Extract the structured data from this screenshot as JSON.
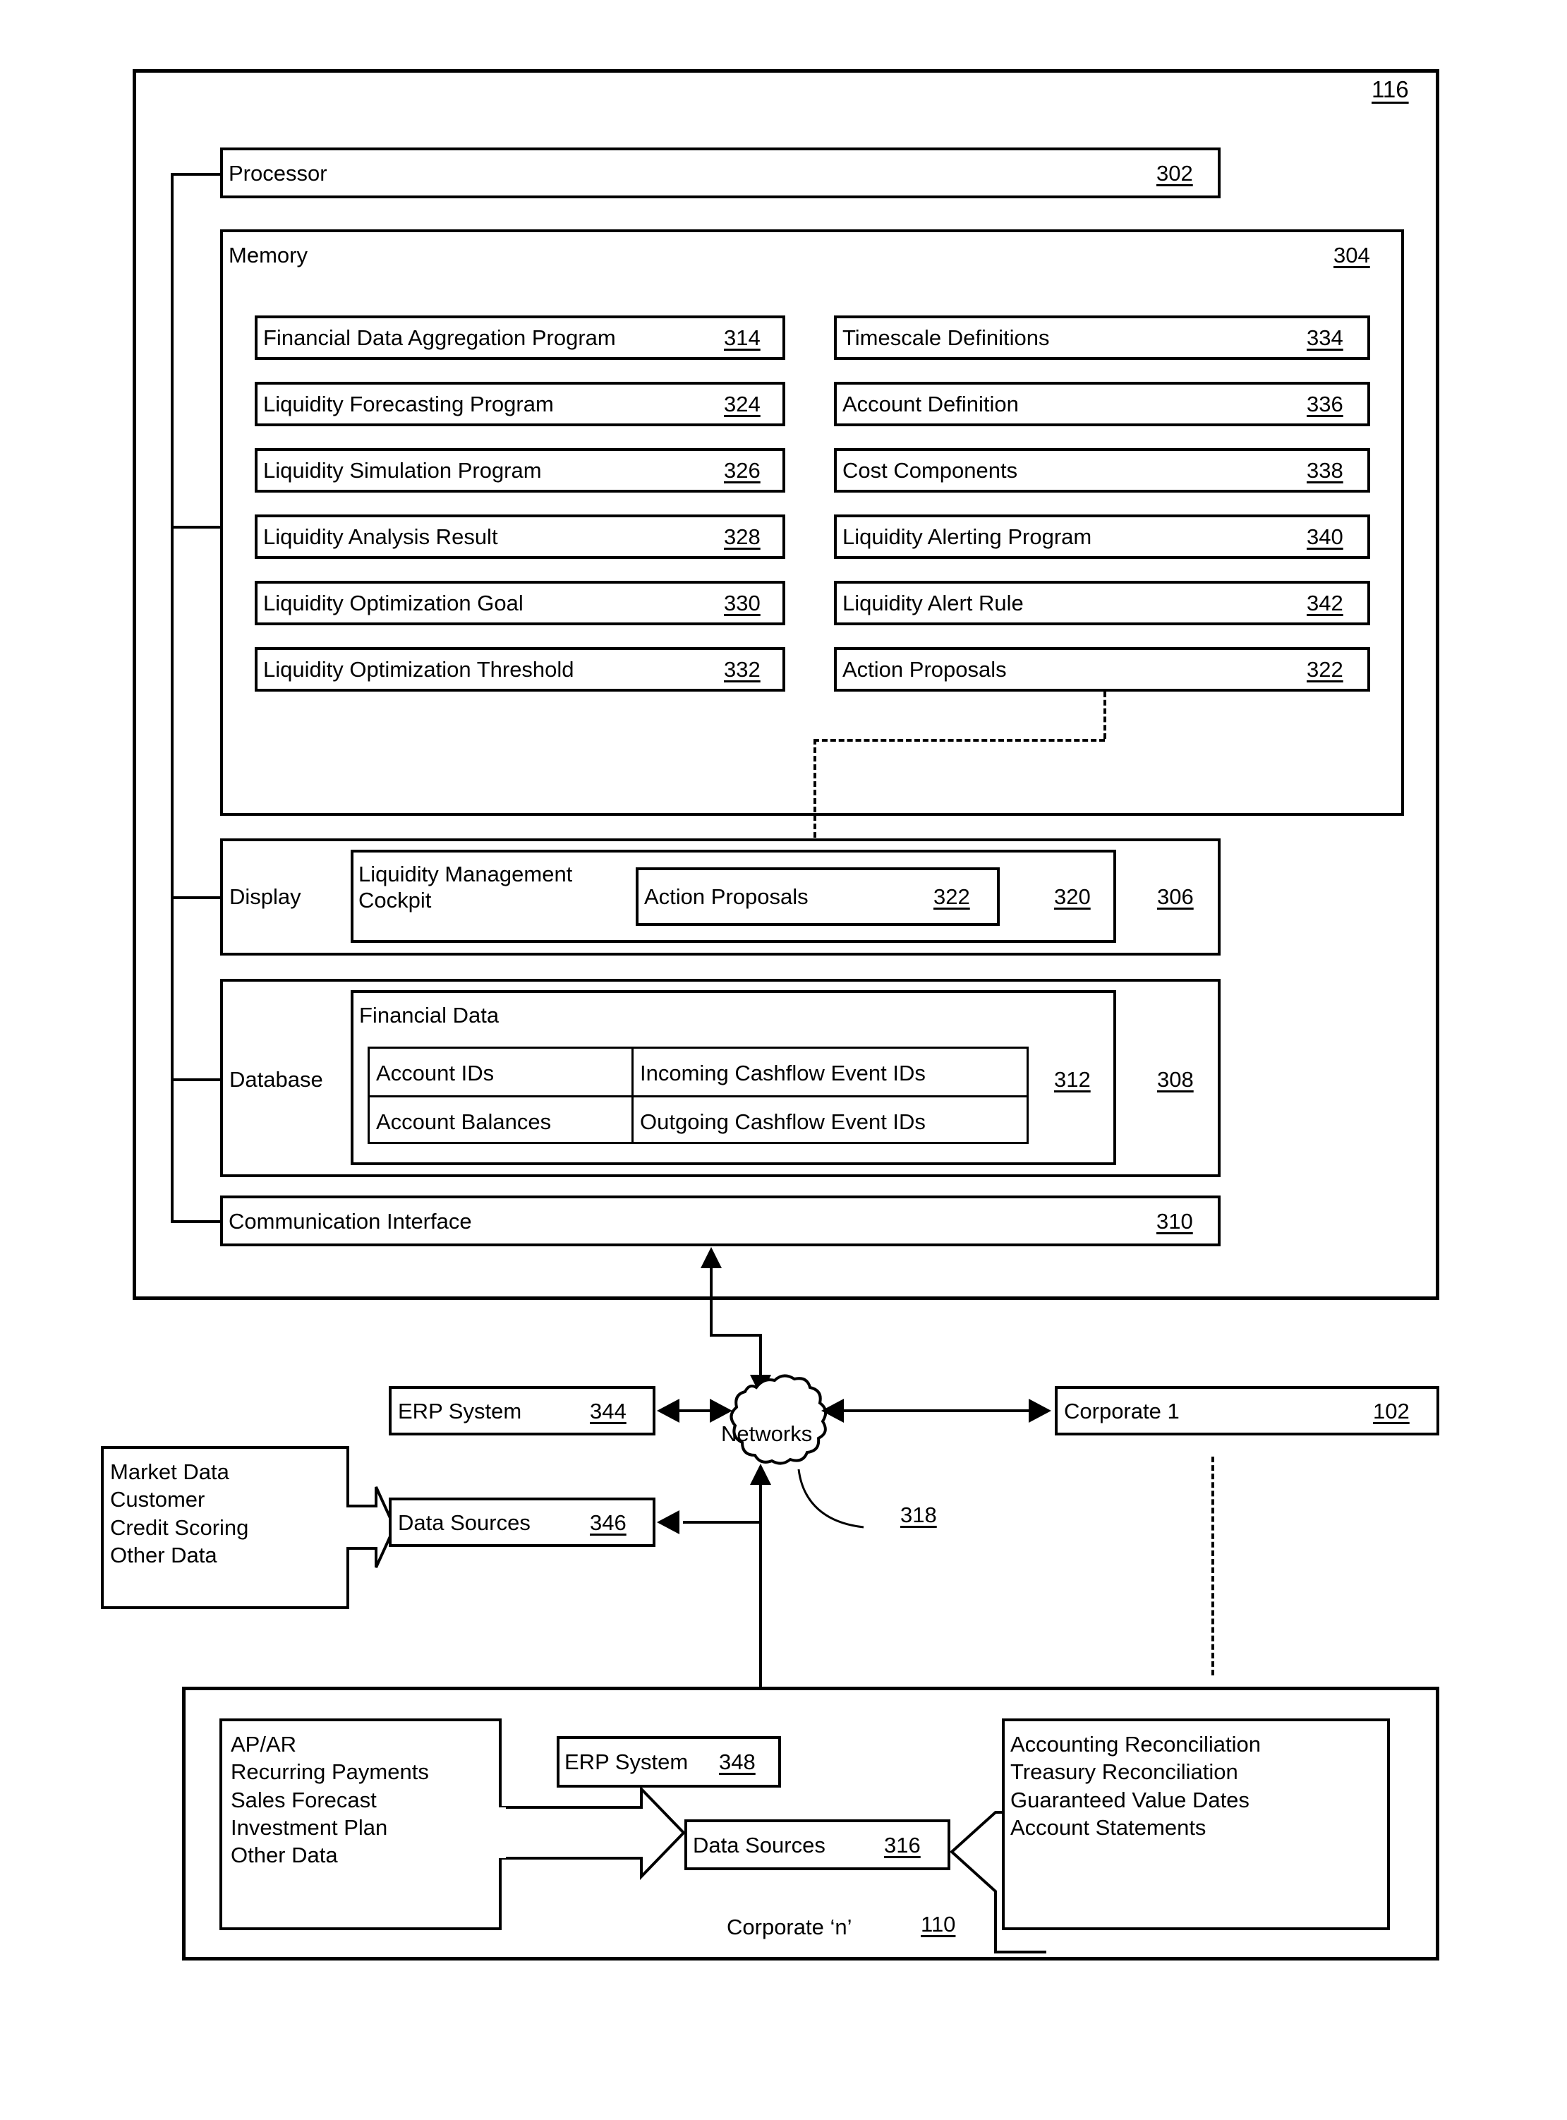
{
  "figure": {
    "system_ref": "116",
    "processor": {
      "label": "Processor",
      "ref": "302"
    },
    "memory": {
      "label": "Memory",
      "ref": "304",
      "left_modules": [
        {
          "label": "Financial Data Aggregation Program",
          "ref": "314"
        },
        {
          "label": "Liquidity Forecasting Program",
          "ref": "324"
        },
        {
          "label": "Liquidity Simulation Program",
          "ref": "326"
        },
        {
          "label": "Liquidity Analysis Result",
          "ref": "328"
        },
        {
          "label": "Liquidity Optimization Goal",
          "ref": "330"
        },
        {
          "label": "Liquidity Optimization Threshold",
          "ref": "332"
        }
      ],
      "right_modules": [
        {
          "label": "Timescale Definitions",
          "ref": "334"
        },
        {
          "label": "Account Definition",
          "ref": "336"
        },
        {
          "label": "Cost Components",
          "ref": "338"
        },
        {
          "label": "Liquidity Alerting Program",
          "ref": "340"
        },
        {
          "label": "Liquidity Alert Rule",
          "ref": "342"
        },
        {
          "label": "Action Proposals",
          "ref": "322"
        }
      ]
    },
    "display": {
      "label": "Display",
      "ref": "306",
      "cockpit_label": "Liquidity Management\nCockpit",
      "cockpit_ref": "320",
      "action_proposals_label": "Action Proposals",
      "action_proposals_ref": "322"
    },
    "database": {
      "label": "Database",
      "ref": "308",
      "financial_data_label": "Financial Data",
      "financial_data_ref": "312",
      "table": [
        [
          "Account IDs",
          "Incoming Cashflow Event IDs"
        ],
        [
          "Account Balances",
          "Outgoing Cashflow Event IDs"
        ]
      ]
    },
    "communication_interface": {
      "label": "Communication Interface",
      "ref": "310"
    },
    "network": {
      "label": "Networks",
      "ref": "318"
    },
    "erp_top": {
      "label": "ERP System",
      "ref": "344"
    },
    "data_sources_top": {
      "label": "Data Sources",
      "ref": "346"
    },
    "market_data_list": "Market Data\nCustomer\nCredit Scoring\nOther Data",
    "corporate_1": {
      "label": "Corporate 1",
      "ref": "102"
    },
    "corporate_n": {
      "label": "Corporate ‘n’",
      "ref": "110",
      "erp": {
        "label": "ERP System",
        "ref": "348"
      },
      "data_sources": {
        "label": "Data Sources",
        "ref": "316"
      },
      "inputs_list": "AP/AR\nRecurring Payments\nSales Forecast\nInvestment Plan\nOther Data",
      "outputs_list": "Accounting Reconciliation\nTreasury Reconciliation\nGuaranteed Value Dates\nAccount Statements"
    }
  }
}
